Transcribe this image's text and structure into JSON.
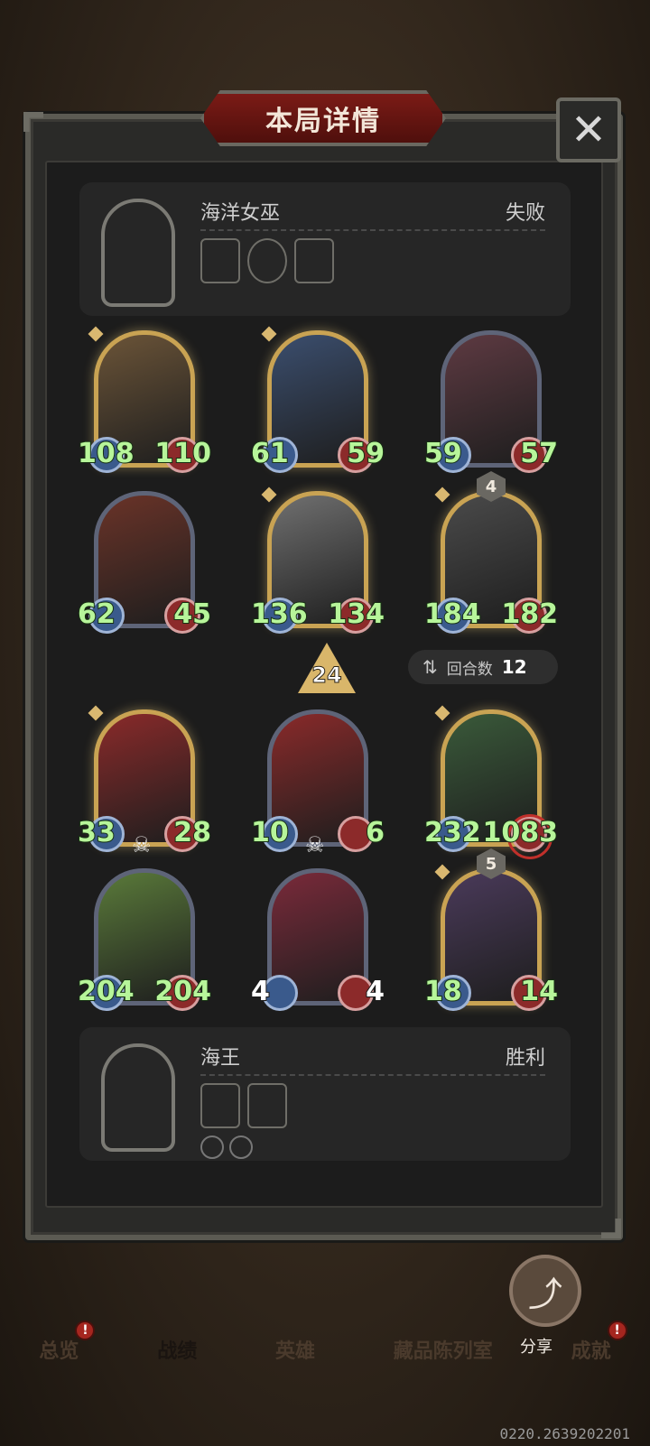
{
  "title": "本局详情",
  "close_symbol": "✕",
  "top_player": {
    "name": "海洋女巫",
    "result": "失败",
    "portrait_color": "#5a4a7a",
    "items": [
      {
        "icon": "cauldron-icon",
        "color": "#6b4a86"
      },
      {
        "icon": "orb-icon",
        "color": "#a8b6c8"
      },
      {
        "icon": "book-icon",
        "color": "#3f6b3a"
      }
    ]
  },
  "enemy_units": [
    {
      "atk": "108",
      "hp": "110",
      "gold": true,
      "color": "#6b5438"
    },
    {
      "atk": "61",
      "hp": "59",
      "gold": true,
      "color": "#3b4e6e"
    },
    {
      "atk": "59",
      "hp": "57",
      "gold": false,
      "color": "#5e3a42"
    },
    {
      "atk": "62",
      "hp": "45",
      "gold": false,
      "color": "#6a3328"
    },
    {
      "atk": "136",
      "hp": "134",
      "gold": true,
      "color": "#707070"
    },
    {
      "atk": "184",
      "hp": "182",
      "gold": true,
      "color": "#4a4a4a",
      "tier": "4"
    }
  ],
  "level": "24",
  "rounds": {
    "label": "回合数",
    "value": "12",
    "icon": "swap-icon"
  },
  "ally_units": [
    {
      "atk": "33",
      "hp": "28",
      "gold": true,
      "color": "#8a2a2a",
      "dead": true
    },
    {
      "atk": "10",
      "hp": "6",
      "gold": false,
      "color": "#8a2a2a",
      "dead": true
    },
    {
      "atk": "232",
      "hp": "1083",
      "gold": true,
      "color": "#3a5a3a",
      "targeted": true
    },
    {
      "atk": "204",
      "hp": "204",
      "gold": false,
      "color": "#5a7a3a"
    },
    {
      "atk": "4",
      "hp": "4",
      "gold": false,
      "color": "#7a2a3a"
    },
    {
      "atk": "18",
      "hp": "14",
      "gold": true,
      "color": "#4a3a5a",
      "tier": "5"
    }
  ],
  "skull_symbol": "☠",
  "bottom_player": {
    "name": "海王",
    "result": "胜利",
    "portrait_color": "#8a3a3a",
    "items": [
      {
        "icon": "hero-item-icon",
        "color": "#3a4a6a"
      },
      {
        "icon": "book-icon",
        "color": "#3f6b3a"
      }
    ],
    "traits": [
      {
        "icon": "sword-trait-icon",
        "color": "#4a6a8a"
      },
      {
        "icon": "claw-trait-icon",
        "color": "#b88a2a"
      }
    ]
  },
  "share": {
    "label": "分享",
    "icon_symbol": "⤴"
  },
  "tabs": [
    {
      "label": "总览",
      "badge": true
    },
    {
      "label": "战绩",
      "active": true
    },
    {
      "label": "英雄"
    },
    {
      "label": "藏品陈列室"
    },
    {
      "label": "成就",
      "badge": true
    }
  ],
  "badge_symbol": "!",
  "uid": "0220.2639202201"
}
